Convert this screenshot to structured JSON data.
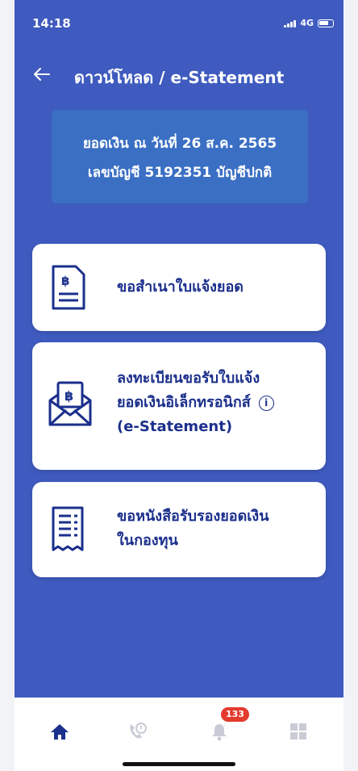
{
  "status_bar": {
    "time": "14:18",
    "network": "4G"
  },
  "header": {
    "back_icon": "arrow-left-icon",
    "title": "ดาวน์โหลด / e-Statement"
  },
  "account_info": {
    "balance_date": "ยอดเงิน ณ วันที่ 26 ส.ค. 2565",
    "account_line": "เลขบัญชี 5192351 บัญชีปกติ"
  },
  "menu": {
    "request_copy": {
      "label": "ขอสำเนาใบแจ้งยอด",
      "icon": "baht-document-icon"
    },
    "register_estatement": {
      "label_line1": "ลงทะเบียนขอรับใบแจ้ง",
      "label_line2": "ยอดเงินอิเล็กทรอนิกส์",
      "label_line3": "(e-Statement)",
      "icon": "baht-envelope-icon",
      "info_glyph": "i"
    },
    "certificate": {
      "label_line1": "ขอหนังสือรับรองยอดเงิน",
      "label_line2": "ในกองทุน",
      "icon": "receipt-icon"
    }
  },
  "bottom_nav": {
    "items": [
      "home-icon",
      "support-icon",
      "bell-icon",
      "grid-icon"
    ],
    "notification_count": "133"
  },
  "colors": {
    "background": "#3f5bbf",
    "account_box": "#3a6fc4",
    "card_text": "#1b2f8c",
    "badge": "#e33b2e",
    "nav_active": "#1b2f8c",
    "nav_inactive": "#c9ccd6"
  }
}
